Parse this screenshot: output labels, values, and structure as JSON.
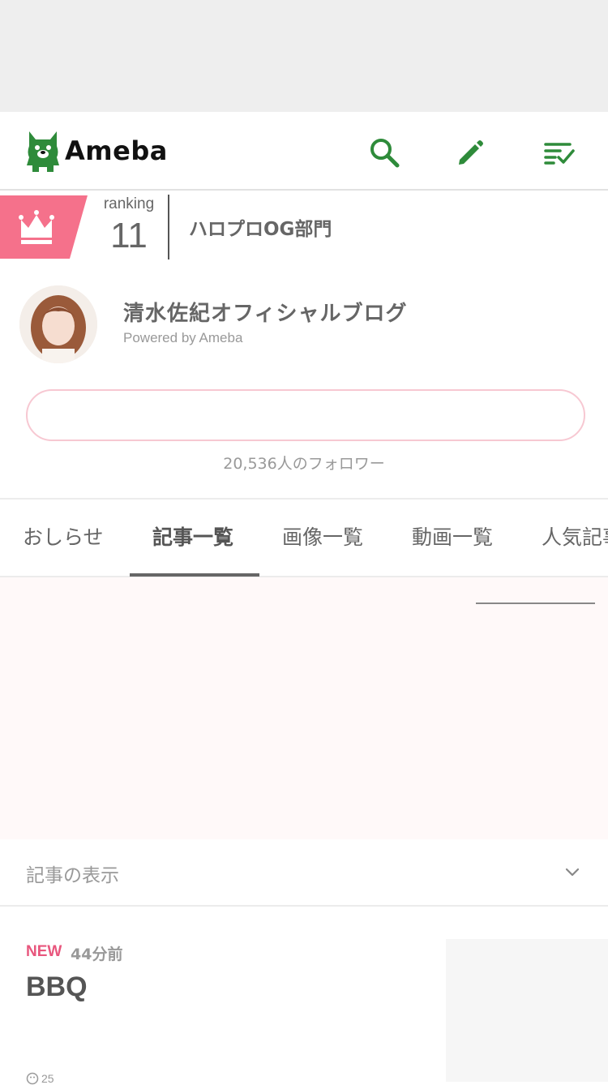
{
  "header": {
    "logo_text": "Ameba",
    "brand_color": "#2e8b3a",
    "icons": [
      "search-icon",
      "pencil-icon",
      "checklist-icon"
    ]
  },
  "ranking": {
    "label": "ranking",
    "position": "11",
    "category": "ハロプロOG部門",
    "badge_color": "#f5718b",
    "icon": "crown-icon"
  },
  "blog": {
    "title": "清水佐紀オフィシャルブログ",
    "powered_by": "Powered by Ameba",
    "followers_text": "20,536人のフォロワー"
  },
  "tabs": [
    {
      "label": "おしらせ",
      "active": false
    },
    {
      "label": "記事一覧",
      "active": true
    },
    {
      "label": "画像一覧",
      "active": false
    },
    {
      "label": "動画一覧",
      "active": false
    },
    {
      "label": "人気記事",
      "active": false
    }
  ],
  "display_options": {
    "label": "記事の表示",
    "icon": "chevron-down-icon"
  },
  "entry": {
    "new_badge": "NEW",
    "time_ago": "44分前",
    "title": "BBQ",
    "like_count": "25"
  },
  "colors": {
    "accent_pink": "#e8567d",
    "ad_background": "#fff9f9"
  }
}
